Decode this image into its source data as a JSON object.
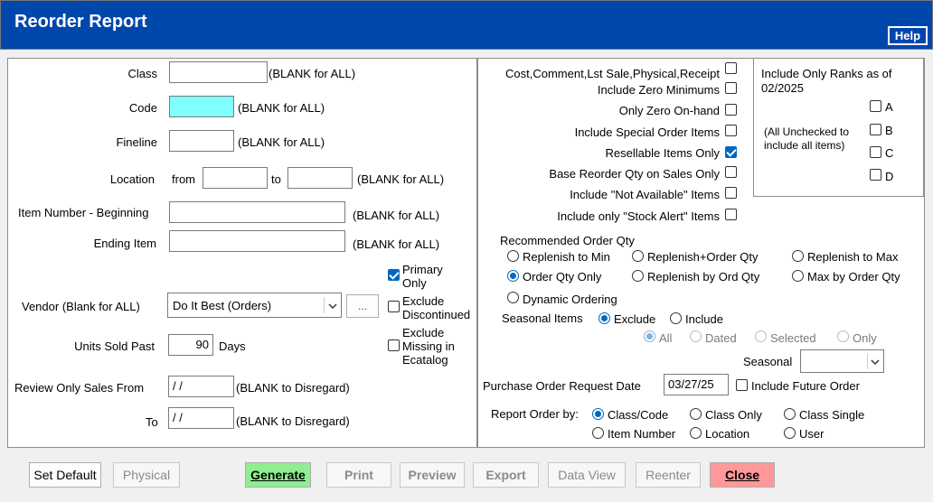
{
  "title": "Reorder Report",
  "help_label": "Help",
  "left": {
    "class_label": "Class",
    "class_hint": "(BLANK for ALL)",
    "code_label": "Code",
    "code_hint": "(BLANK for ALL)",
    "fineline_label": "Fineline",
    "fineline_hint": "(BLANK for ALL)",
    "location_label": "Location",
    "location_from": "from",
    "location_to": "to",
    "location_hint": "(BLANK for ALL)",
    "item_begin_label": "Item Number - Beginning",
    "item_begin_hint": "(BLANK for ALL)",
    "item_end_label": "Ending Item",
    "item_end_hint": "(BLANK for ALL)",
    "primary_only": "Primary Only",
    "exclude_discontinued": "Exclude Discontinued",
    "exclude_missing": "Exclude Missing in Ecatalog",
    "vendor_label": "Vendor (Blank for ALL)",
    "vendor_value": "Do It Best (Orders)",
    "vendor_browse": "...",
    "units_sold_label": "Units Sold Past",
    "units_sold_value": "90",
    "units_sold_unit": "Days",
    "review_from_label": "Review Only Sales From",
    "review_from_value": " /  /",
    "review_from_hint": "(BLANK to Disregard)",
    "review_to_label": "To",
    "review_to_value": " /  /",
    "review_to_hint": "(BLANK to Disregard)"
  },
  "right": {
    "checks": [
      {
        "label": "Cost,Comment,Lst Sale,Physical,Receipt",
        "checked": false
      },
      {
        "label": "Include Zero Minimums",
        "checked": false
      },
      {
        "label": "Only Zero On-hand",
        "checked": false
      },
      {
        "label": "Include Special  Order Items",
        "checked": false
      },
      {
        "label": "Resellable Items Only",
        "checked": true
      },
      {
        "label": "Base Reorder Qty on Sales Only",
        "checked": false
      },
      {
        "label": "Include \"Not Available\" Items",
        "checked": false
      },
      {
        "label": "Include only \"Stock Alert\" Items",
        "checked": false
      }
    ],
    "ranks_title": "Include Only Ranks as of 02/2025",
    "ranks_note": "(All Unchecked to include all items)",
    "ranks": [
      "A",
      "B",
      "C",
      "D"
    ],
    "rec_title": "Recommended Order Qty",
    "rec_options": [
      "Replenish to Min",
      "Replenish+Order Qty",
      "Replenish to Max",
      "Order Qty Only",
      "Replenish by Ord Qty",
      "Max by Order Qty",
      "Dynamic Ordering"
    ],
    "rec_selected": "Order Qty Only",
    "seasonal_label": "Seasonal Items",
    "seasonal_opts": [
      "Exclude",
      "Include"
    ],
    "seasonal_sub": [
      "All",
      "Dated",
      "Selected",
      "Only"
    ],
    "seasonal_select_label": "Seasonal",
    "po_date_label": "Purchase Order Request Date",
    "po_date_value": "03/27/25",
    "future_label": "Include Future Order",
    "report_order_label": "Report Order by:",
    "report_opts": [
      "Class/Code",
      "Class Only",
      "Class Single",
      "Item Number",
      "Location",
      "User"
    ],
    "report_selected": "Class/Code"
  },
  "buttons": [
    "Set Default",
    "Physical",
    "Generate",
    "Print",
    "Preview",
    "Export",
    "Data View",
    "Reenter",
    "Close"
  ],
  "colors": {
    "title_bar": "#0047ab",
    "code_field": "#80ffff",
    "generate": "#90ee90",
    "close": "#ff9999"
  }
}
